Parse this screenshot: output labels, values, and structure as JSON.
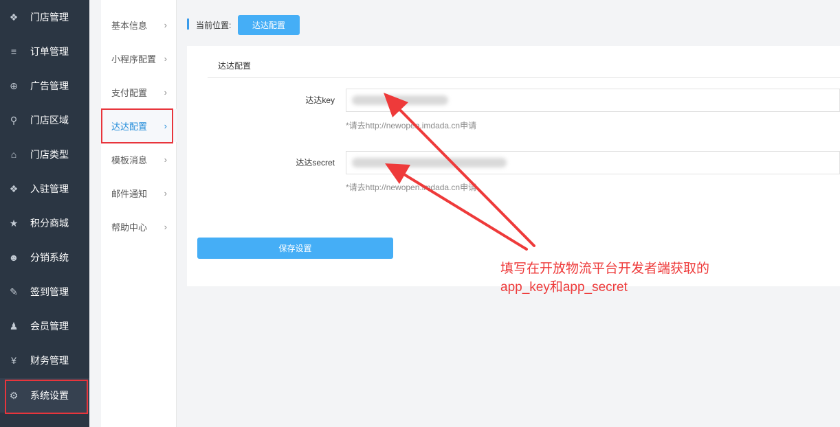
{
  "sidebar": {
    "items": [
      {
        "label": "门店管理",
        "icon": "cubes-icon",
        "glyph": "❖"
      },
      {
        "label": "订单管理",
        "icon": "list-icon",
        "glyph": "≡"
      },
      {
        "label": "广告管理",
        "icon": "life-ring-icon",
        "glyph": "⊕"
      },
      {
        "label": "门店区域",
        "icon": "map-marker-icon",
        "glyph": "⚲"
      },
      {
        "label": "门店类型",
        "icon": "bank-icon",
        "glyph": "⌂"
      },
      {
        "label": "入驻管理",
        "icon": "cubes-icon",
        "glyph": "❖"
      },
      {
        "label": "积分商城",
        "icon": "star-icon",
        "glyph": "★"
      },
      {
        "label": "分销系统",
        "icon": "users-icon",
        "glyph": "☻"
      },
      {
        "label": "签到管理",
        "icon": "edit-icon",
        "glyph": "✎"
      },
      {
        "label": "会员管理",
        "icon": "user-icon",
        "glyph": "♟"
      },
      {
        "label": "财务管理",
        "icon": "yen-icon",
        "glyph": "¥"
      },
      {
        "label": "系统设置",
        "icon": "gear-icon",
        "glyph": "⚙"
      }
    ]
  },
  "submenu": {
    "items": [
      {
        "label": "基本信息"
      },
      {
        "label": "小程序配置"
      },
      {
        "label": "支付配置"
      },
      {
        "label": "达达配置"
      },
      {
        "label": "模板消息"
      },
      {
        "label": "邮件通知"
      },
      {
        "label": "帮助中心"
      }
    ],
    "chevron": "›"
  },
  "breadcrumb": {
    "label": "当前位置:",
    "current": "达达配置"
  },
  "panel": {
    "title": "达达配置",
    "fields": [
      {
        "label": "达达key",
        "hint": "*请去http://newopen.imdada.cn申请"
      },
      {
        "label": "达达secret",
        "hint": "*请去http://newopen.imdada.cn申请"
      }
    ],
    "save_label": "保存设置"
  },
  "annotation": {
    "line1": "填写在开放物流平台开发者端获取的",
    "line2": "app_key和app_secret",
    "color": "#ee3a3a"
  },
  "colors": {
    "sidebar_bg": "#2b3643",
    "accent": "#45aef6",
    "highlight": "#e8353c"
  }
}
